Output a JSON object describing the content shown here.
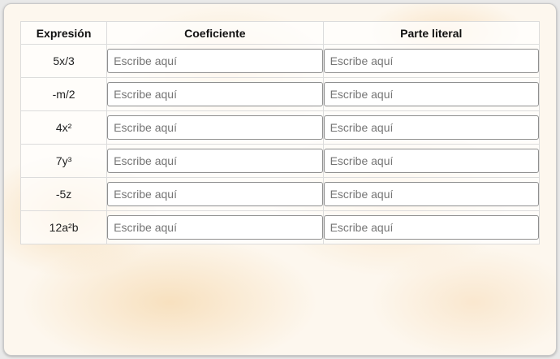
{
  "table": {
    "headers": {
      "expression": "Expresión",
      "coefficient": "Coeficiente",
      "literal": "Parte literal"
    },
    "placeholder": "Escribe aquí",
    "rows": [
      {
        "expression": "5x/3",
        "coefficient_value": "",
        "literal_value": ""
      },
      {
        "expression": "-m/2",
        "coefficient_value": "",
        "literal_value": ""
      },
      {
        "expression": "4x²",
        "coefficient_value": "",
        "literal_value": ""
      },
      {
        "expression": "7y³",
        "coefficient_value": "",
        "literal_value": ""
      },
      {
        "expression": "-5z",
        "coefficient_value": "",
        "literal_value": ""
      },
      {
        "expression": "12a²b",
        "coefficient_value": "",
        "literal_value": ""
      }
    ]
  }
}
